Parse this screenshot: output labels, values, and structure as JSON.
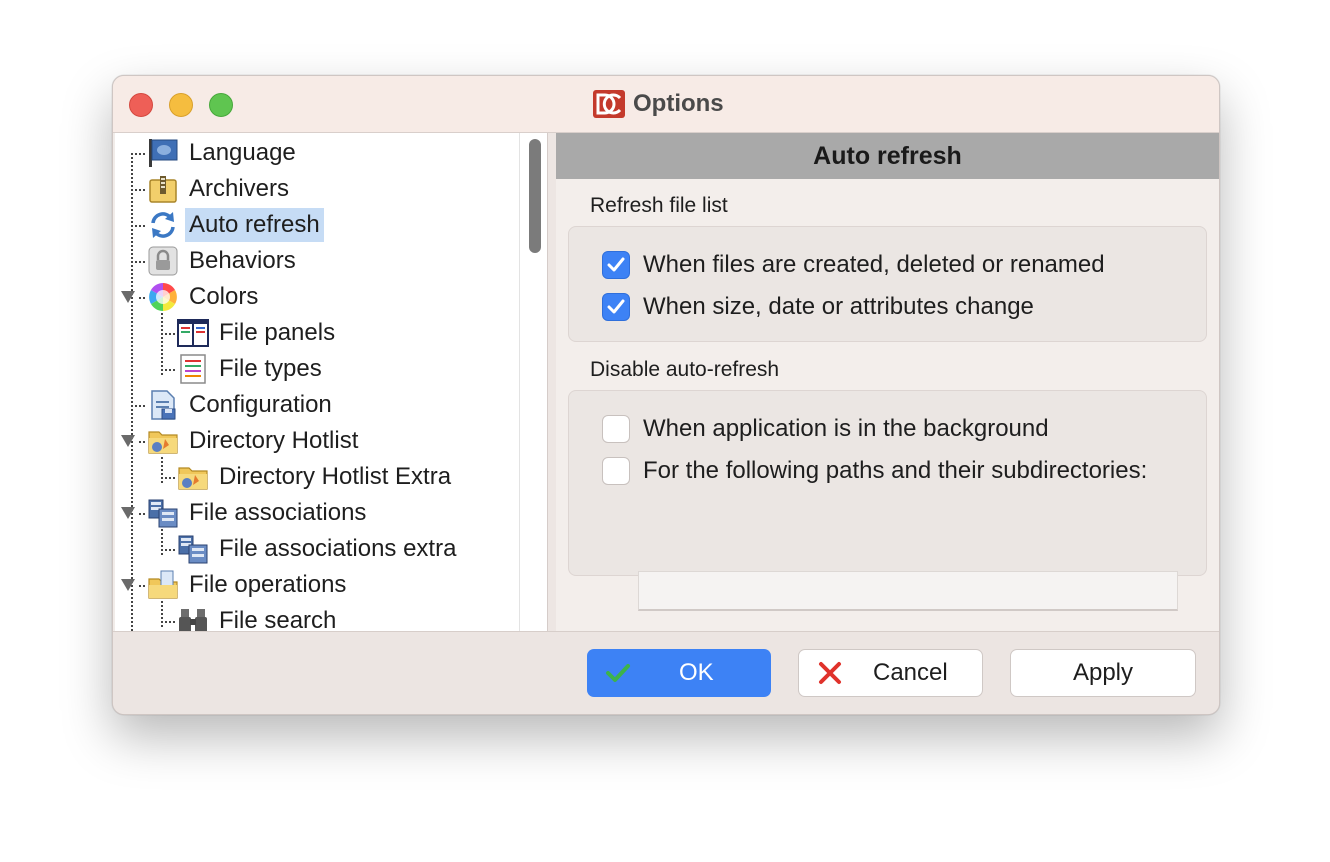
{
  "window": {
    "title": "Options"
  },
  "tree": {
    "items": [
      {
        "label": "Language",
        "icon": "flag-icon",
        "level": 0
      },
      {
        "label": "Archivers",
        "icon": "archive-icon",
        "level": 0
      },
      {
        "label": "Auto refresh",
        "icon": "refresh-icon",
        "level": 0,
        "selected": true
      },
      {
        "label": "Behaviors",
        "icon": "lock-icon",
        "level": 0
      },
      {
        "label": "Colors",
        "icon": "color-wheel-icon",
        "level": 0,
        "expanded": true
      },
      {
        "label": "File panels",
        "icon": "panels-icon",
        "level": 1
      },
      {
        "label": "File types",
        "icon": "file-types-icon",
        "level": 1
      },
      {
        "label": "Configuration",
        "icon": "config-file-icon",
        "level": 0
      },
      {
        "label": "Directory Hotlist",
        "icon": "hotlist-folder-icon",
        "level": 0,
        "expanded": true
      },
      {
        "label": "Directory Hotlist Extra",
        "icon": "hotlist-folder-icon",
        "level": 1
      },
      {
        "label": "File associations",
        "icon": "file-associations-icon",
        "level": 0,
        "expanded": true
      },
      {
        "label": "File associations extra",
        "icon": "file-associations-icon",
        "level": 1
      },
      {
        "label": "File operations",
        "icon": "file-operations-icon",
        "level": 0,
        "expanded": true
      },
      {
        "label": "File search",
        "icon": "binoculars-icon",
        "level": 1
      }
    ]
  },
  "content": {
    "header": "Auto refresh",
    "refresh_section": {
      "title": "Refresh file list",
      "options": [
        {
          "label": "When files are created, deleted or renamed",
          "checked": true
        },
        {
          "label": "When size, date or attributes change",
          "checked": true
        }
      ]
    },
    "disable_section": {
      "title": "Disable auto-refresh",
      "options": [
        {
          "label": "When application is in the background",
          "checked": false
        },
        {
          "label": "For the following paths and their subdirectories:",
          "checked": false
        }
      ],
      "paths_value": ""
    }
  },
  "buttons": {
    "ok": "OK",
    "cancel": "Cancel",
    "apply": "Apply"
  },
  "colors": {
    "accent": "#3d82f5",
    "selection": "#c6dcf5",
    "header_bar": "#a9a9a9",
    "cancel_icon": "#e0322b"
  }
}
